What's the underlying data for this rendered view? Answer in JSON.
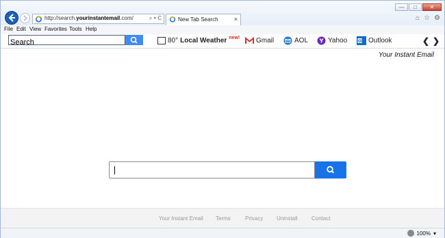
{
  "browser": {
    "url_prefix": "http://search.",
    "url_domain": "yourinstantemail",
    "url_suffix": ".com/",
    "address_tools": "⌕ ▾ C",
    "tab_title": "New Tab Search",
    "tab_close": "×",
    "window_controls": [
      "—",
      "□",
      "✕"
    ],
    "right_icons": [
      "⌂",
      "☆",
      "⚙"
    ]
  },
  "menu": [
    "File",
    "Edit",
    "View",
    "Favorites",
    "Tools",
    "Help"
  ],
  "toolbar": {
    "search_placeholder": "Search",
    "weather_temp": "80°",
    "weather_label": "Local Weather",
    "weather_badge": "new!",
    "links": [
      "Gmail",
      "AOL",
      "Yahoo",
      "Outlook"
    ],
    "prev": "❮",
    "next": "❯"
  },
  "page": {
    "tagline": "Your Instant Email",
    "footer_links": [
      "Your Instant Email",
      "Terms",
      "Privacy",
      "Uninstall",
      "Contact"
    ]
  },
  "status": {
    "zoom": "100%",
    "zoom_arrow": "▾"
  },
  "colors": {
    "search_button": "#1773e7",
    "toolbar_search_button": "#3d8cf0",
    "gmail": "#d93025",
    "aol": "#1f78d6",
    "yahoo": "#6a2bbd",
    "outlook": "#0f6cc7"
  }
}
